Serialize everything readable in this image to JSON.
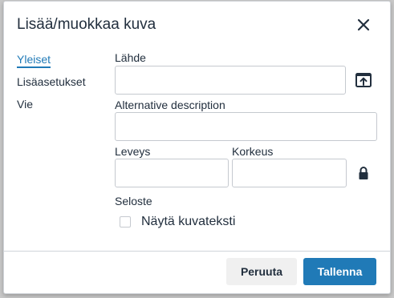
{
  "dialog": {
    "title": "Lisää/muokkaa kuva",
    "close_icon": "close-icon"
  },
  "nav": {
    "items": [
      {
        "label": "Yleiset",
        "active": true
      },
      {
        "label": "Lisäasetukset",
        "active": false
      },
      {
        "label": "Vie",
        "active": false
      }
    ]
  },
  "form": {
    "source_label": "Lähde",
    "source_value": "",
    "browse_icon": "upload-icon",
    "alt_label": "Alternative description",
    "alt_value": "",
    "width_label": "Leveys",
    "width_value": "",
    "height_label": "Korkeus",
    "height_value": "",
    "lock_icon": "lock-icon",
    "caption_section_label": "Seloste",
    "show_caption_label": "Näytä kuvateksti",
    "show_caption_checked": false
  },
  "footer": {
    "cancel_label": "Peruuta",
    "save_label": "Tallenna"
  },
  "colors": {
    "accent": "#207ab7",
    "text": "#222f3e",
    "border": "#c5c9cf",
    "secondary_button_bg": "#f0f0f0"
  }
}
